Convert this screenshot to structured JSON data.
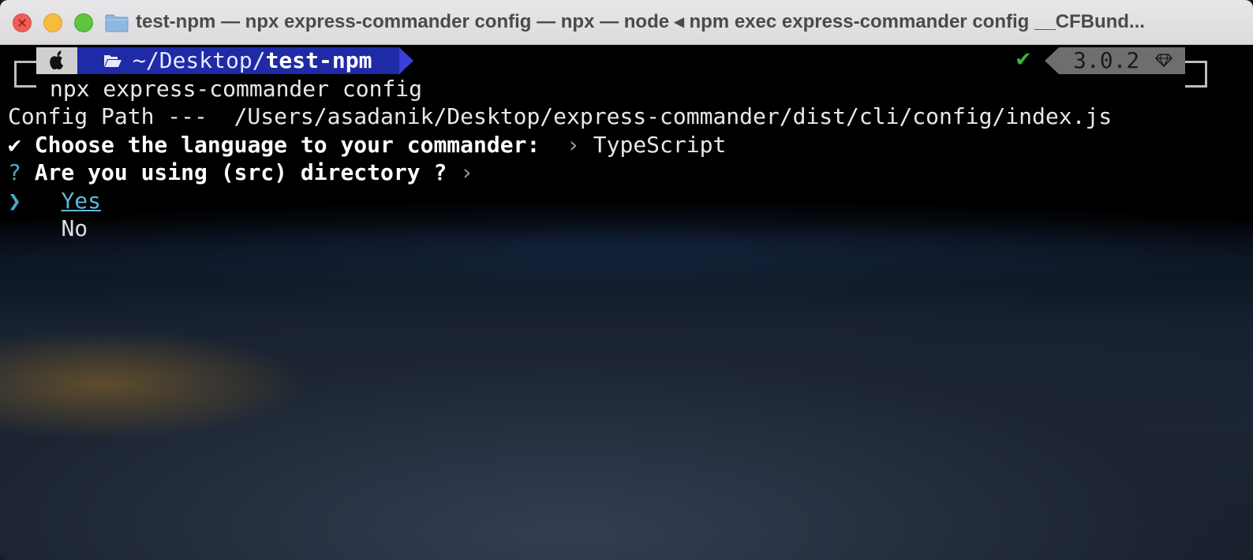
{
  "window": {
    "title": "test-npm — npx express-commander config — npx — node ◂ npm exec express-commander config __CFBund..."
  },
  "prompt": {
    "path_prefix": "~/Desktop/",
    "path_current": "test-npm",
    "status_check": "✔",
    "version": "3.0.2",
    "command": "npx express-commander config"
  },
  "output": {
    "config_path_label": "Config Path ---  ",
    "config_path_value": "/Users/asadanik/Desktop/express-commander/dist/cli/config/index.js",
    "q1_mark": "✔",
    "q1_text": "Choose the language to your commander:",
    "q1_sep": "›",
    "q1_answer": "TypeScript",
    "q2_mark": "?",
    "q2_text": "Are you using (src) directory ?",
    "q2_sep": "›",
    "pointer": "❯",
    "options": [
      "Yes",
      "No"
    ]
  },
  "colors": {
    "accent_green": "#3bb33b",
    "accent_cyan": "#4fa8c9",
    "path_segment": "#1e2aa6",
    "traffic_close": "#ee5e57",
    "traffic_min": "#f6bd3c",
    "traffic_max": "#5fc53f"
  },
  "icons": {
    "title_folder": "folder-icon",
    "apple": "apple-icon",
    "path_folder": "open-folder-icon",
    "version": "gem-icon"
  }
}
